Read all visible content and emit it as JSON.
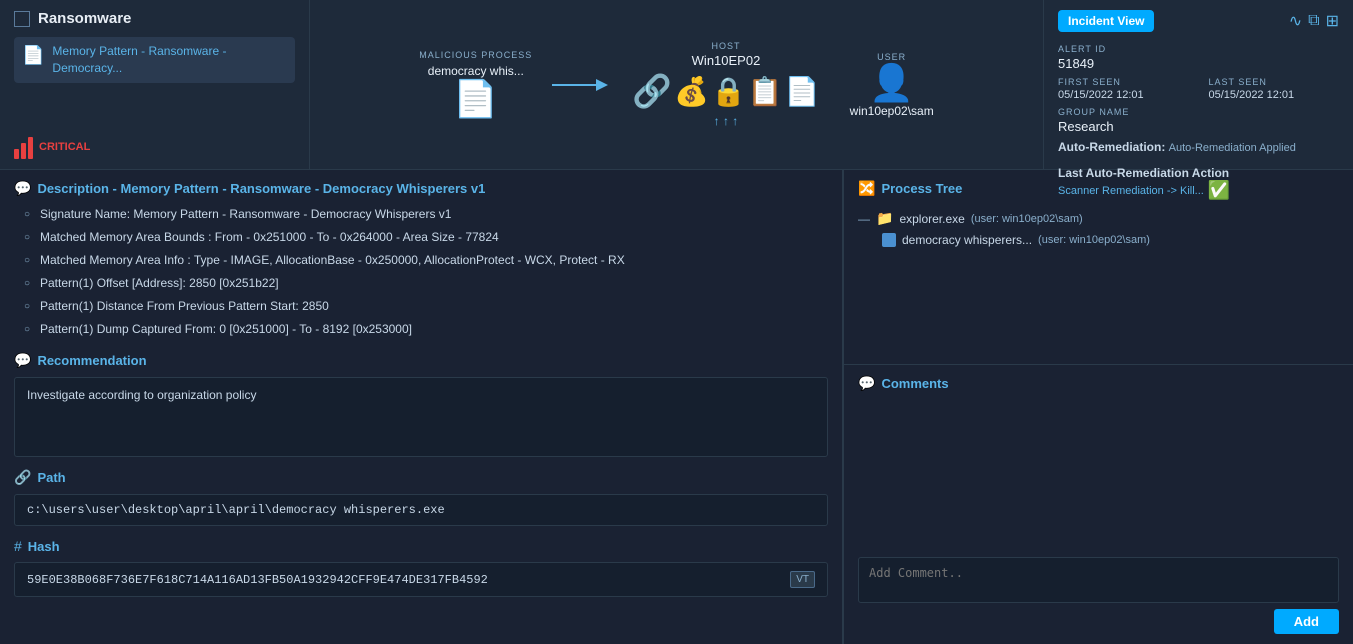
{
  "header": {
    "title": "Ransomware",
    "checkbox_label": "Ransomware",
    "alert_item": {
      "label": "Memory Pattern - Ransomware - Democracy...",
      "icon": "📄"
    },
    "critical_label": "CRITICAL"
  },
  "visualization": {
    "malicious_process_label": "MALICIOUS PROCESS",
    "malicious_process_name": "democracy whis...",
    "host_label": "HOST",
    "host_name": "Win10EP02",
    "user_label": "USER",
    "user_name": "win10ep02\\sam"
  },
  "alert_info": {
    "alert_id_label": "ALERT ID",
    "alert_id": "51849",
    "first_seen_label": "FIRST SEEN",
    "first_seen": "05/15/2022 12:01",
    "last_seen_label": "LAST SEEN",
    "last_seen": "05/15/2022 12:01",
    "group_name_label": "GROUP NAME",
    "group_name": "Research",
    "incident_view_btn": "Incident View",
    "auto_remediation_label": "Auto-Remediation:",
    "auto_remediation_value": "Auto-Remediation Applied",
    "last_auto_rem_label": "Last Auto-Remediation Action",
    "last_auto_rem_value": "Scanner Remediation -> Kill..."
  },
  "description": {
    "section_title": "Description - Memory Pattern - Ransomware - Democracy Whisperers v1",
    "items": [
      "Signature Name: Memory Pattern - Ransomware - Democracy Whisperers v1",
      "Matched Memory Area Bounds : From - 0x251000 - To - 0x264000 - Area Size - 77824",
      "Matched Memory Area Info : Type - IMAGE, AllocationBase - 0x250000, AllocationProtect - WCX, Protect - RX",
      "Pattern(1) Offset [Address]: 2850 [0x251b22]",
      "Pattern(1) Distance From Previous Pattern Start: 2850",
      "Pattern(1) Dump Captured From: 0 [0x251000] - To - 8192 [0x253000]"
    ]
  },
  "recommendation": {
    "section_title": "Recommendation",
    "text": "Investigate according to organization policy"
  },
  "path": {
    "section_title": "Path",
    "value": "c:\\users\\user\\desktop\\april\\april\\democracy whisperers.exe"
  },
  "hash": {
    "section_title": "Hash",
    "value": "59E0E38B068F736E7F618C714A116AD13FB50A1932942CFF9E474DE317FB4592",
    "vt_badge": "VT"
  },
  "process_tree": {
    "section_title": "Process Tree",
    "items": [
      {
        "name": "explorer.exe",
        "user": "(user: win10ep02\\sam)",
        "indent": 0,
        "icon_type": "folder"
      },
      {
        "name": "democracy whisperers...",
        "user": "(user: win10ep02\\sam)",
        "indent": 1,
        "icon_type": "app"
      }
    ]
  },
  "comments": {
    "section_title": "Comments",
    "add_placeholder": "Add Comment..",
    "add_btn_label": "Add"
  },
  "icons": {
    "search": "⚙",
    "waveform": "∿",
    "grid": "⊞",
    "columns": "▦"
  }
}
